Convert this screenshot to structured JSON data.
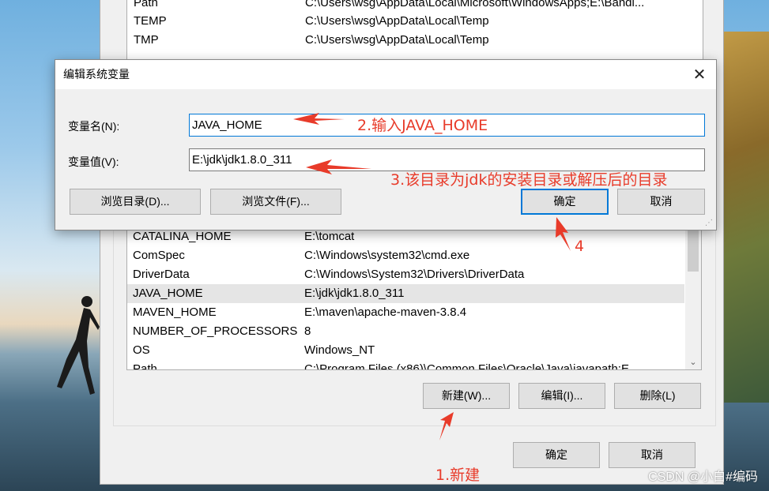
{
  "user_vars_partial": [
    {
      "name": "Path",
      "value": "C:\\Users\\wsg\\AppData\\Local\\Microsoft\\WindowsApps;E:\\Bandi..."
    },
    {
      "name": "TEMP",
      "value": "C:\\Users\\wsg\\AppData\\Local\\Temp"
    },
    {
      "name": "TMP",
      "value": "C:\\Users\\wsg\\AppData\\Local\\Temp"
    }
  ],
  "edit_dialog": {
    "title": "编辑系统变量",
    "name_label": "变量名(N):",
    "name_value": "JAVA_HOME",
    "value_label": "变量值(V):",
    "value_value": "E:\\jdk\\jdk1.8.0_311",
    "browse_dir": "浏览目录(D)...",
    "browse_file": "浏览文件(F)...",
    "ok": "确定",
    "cancel": "取消"
  },
  "system_vars": [
    {
      "name": "CATALINA_HOME",
      "value": "E:\\tomcat"
    },
    {
      "name": "ComSpec",
      "value": "C:\\Windows\\system32\\cmd.exe"
    },
    {
      "name": "DriverData",
      "value": "C:\\Windows\\System32\\Drivers\\DriverData"
    },
    {
      "name": "JAVA_HOME",
      "value": "E:\\jdk\\jdk1.8.0_311",
      "selected": true
    },
    {
      "name": "MAVEN_HOME",
      "value": "E:\\maven\\apache-maven-3.8.4"
    },
    {
      "name": "NUMBER_OF_PROCESSORS",
      "value": "8"
    },
    {
      "name": "OS",
      "value": "Windows_NT"
    },
    {
      "name": "Path",
      "value": "C:\\Program Files (x86)\\Common Files\\Oracle\\Java\\javapath;E..."
    }
  ],
  "sys_buttons": {
    "new": "新建(W)...",
    "edit": "编辑(I)...",
    "delete": "删除(L)"
  },
  "dialog_buttons": {
    "ok": "确定",
    "cancel": "取消"
  },
  "annotations": {
    "step1": "1.新建",
    "step2": "2.输入JAVA_HOME",
    "step3": "3.该目录为jdk的安装目录或解压后的目录",
    "step4": "4"
  },
  "watermark": "CSDN @小白#编码",
  "colors": {
    "annotation": "#e83b2a",
    "focus": "#0078d7",
    "selected_row": "#e5e5e5"
  }
}
